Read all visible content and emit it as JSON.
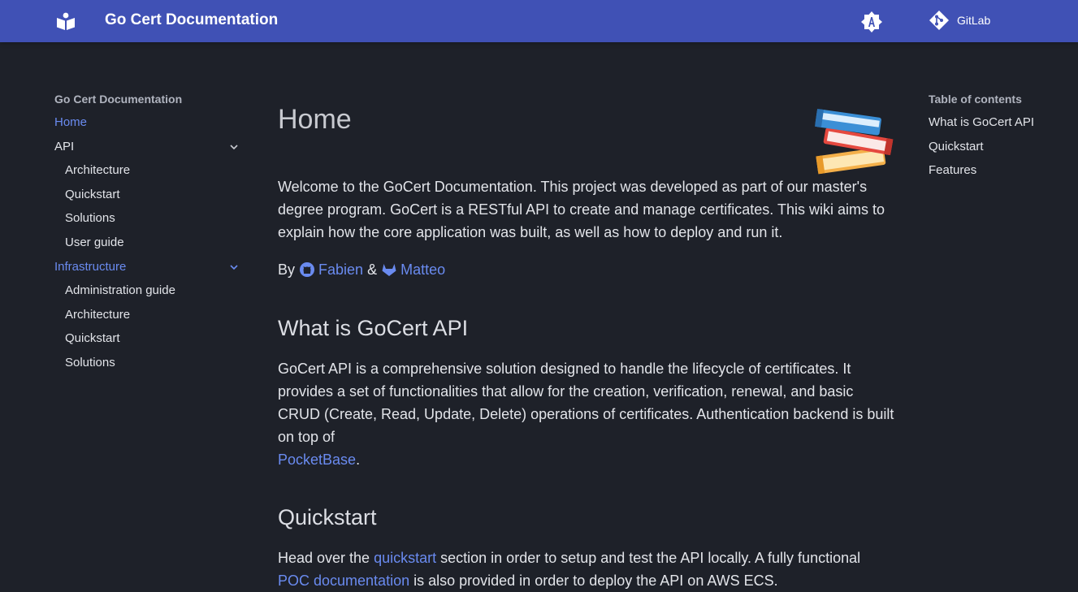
{
  "header": {
    "title": "Go Cert Documentation",
    "repo_label": "GitLab"
  },
  "nav": {
    "title": "Go Cert Documentation",
    "items": [
      {
        "label": "Home"
      },
      {
        "label": "API"
      },
      {
        "label": "Architecture"
      },
      {
        "label": "Quickstart"
      },
      {
        "label": "Solutions"
      },
      {
        "label": "User guide"
      },
      {
        "label": "Infrastructure"
      },
      {
        "label": "Administration guide"
      },
      {
        "label": "Architecture"
      },
      {
        "label": "Quickstart"
      },
      {
        "label": "Solutions"
      }
    ]
  },
  "toc": {
    "title": "Table of contents",
    "items": [
      {
        "label": "What is GoCert API"
      },
      {
        "label": "Quickstart"
      },
      {
        "label": "Features"
      }
    ]
  },
  "content": {
    "title": "Home",
    "intro": "Welcome to the GoCert Documentation. This project was developed as part of our master's degree program. GoCert is a RESTful API to create and manage certificates. This wiki aims to explain how the core application was built, as well as how to deploy and run it.",
    "authors": {
      "by": "By",
      "author1": "Fabien",
      "amp": "&",
      "author2": "Matteo"
    },
    "section1": {
      "heading": "What is GoCert API",
      "text": "GoCert API is a comprehensive solution designed to handle the lifecycle of certificates. It provides a set of functionalities that allow for the creation, verification, renewal, and basic CRUD (Create, Read, Update, Delete) operations of certificates. Authentication backend is built on top of",
      "link": "PocketBase",
      "end": "."
    },
    "section2": {
      "heading": "Quickstart",
      "text1": "Head over the",
      "link1": "quickstart",
      "text2": "section in order to setup and test the API locally. A fully functional",
      "link2": "POC documentation",
      "text3": "is also provided in order to deploy the API on AWS ECS."
    }
  },
  "colors": {
    "header": "#4051b5",
    "background": "#1e2129",
    "link": "#6a8bf0"
  }
}
